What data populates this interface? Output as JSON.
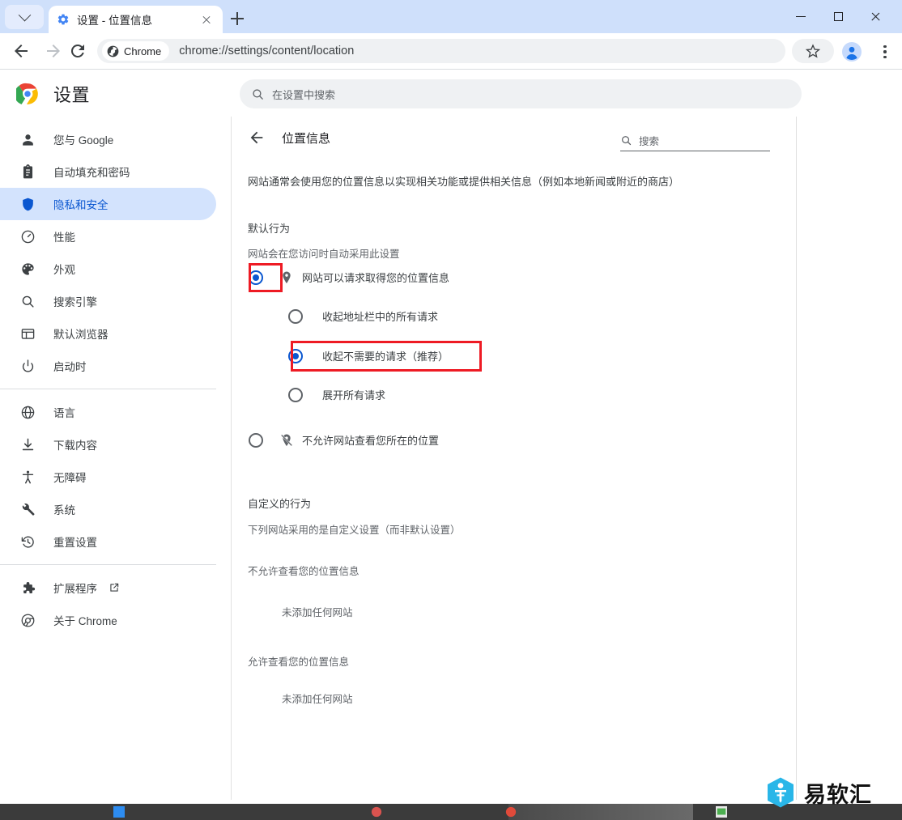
{
  "window": {
    "tab": {
      "title": "设置 - 位置信息",
      "favicon": "gear-icon"
    },
    "new_tab_label": "+",
    "controls": {
      "minimize": "–",
      "maximize": "□",
      "close": "✕"
    }
  },
  "toolbar": {
    "back": "back-arrow-icon",
    "forward": "forward-arrow-icon",
    "reload": "reload-icon",
    "chip_label": "Chrome",
    "url": "chrome://settings/content/location",
    "bookmark": "star-icon",
    "profile": "avatar-icon",
    "menu": "kebab-menu-icon"
  },
  "settings_header": {
    "title": "设置",
    "search_placeholder": "在设置中搜索"
  },
  "sidebar": {
    "items": [
      {
        "label": "您与 Google",
        "icon": "person-icon",
        "active": false
      },
      {
        "label": "自动填充和密码",
        "icon": "clipboard-icon",
        "active": false
      },
      {
        "label": "隐私和安全",
        "icon": "shield-icon",
        "active": true
      },
      {
        "label": "性能",
        "icon": "speedometer-icon",
        "active": false
      },
      {
        "label": "外观",
        "icon": "palette-icon",
        "active": false
      },
      {
        "label": "搜索引擎",
        "icon": "search-icon",
        "active": false
      },
      {
        "label": "默认浏览器",
        "icon": "browser-window-icon",
        "active": false
      },
      {
        "label": "启动时",
        "icon": "power-icon",
        "active": false
      }
    ],
    "items2": [
      {
        "label": "语言",
        "icon": "globe-icon",
        "active": false
      },
      {
        "label": "下载内容",
        "icon": "download-icon",
        "active": false
      },
      {
        "label": "无障碍",
        "icon": "accessibility-icon",
        "active": false
      },
      {
        "label": "系统",
        "icon": "wrench-icon",
        "active": false
      },
      {
        "label": "重置设置",
        "icon": "history-restore-icon",
        "active": false
      }
    ],
    "items3": [
      {
        "label": "扩展程序",
        "icon": "puzzle-icon",
        "external": true,
        "active": false
      },
      {
        "label": "关于 Chrome",
        "icon": "chrome-icon",
        "external": false,
        "active": false
      }
    ]
  },
  "main": {
    "back_icon": "back-arrow-icon",
    "page_title": "位置信息",
    "search_placeholder": "搜索",
    "description": "网站通常会使用您的位置信息以实现相关功能或提供相关信息（例如本地新闻或附近的商店）",
    "default_behavior": {
      "title": "默认行为",
      "subtitle": "网站会在您访问时自动采用此设置",
      "options": [
        {
          "label": "网站可以请求取得您的位置信息",
          "icon": "location-pin-icon",
          "checked": true,
          "highlighted": true
        },
        {
          "label": "不允许网站查看您所在的位置",
          "icon": "location-pin-off-icon",
          "checked": false,
          "highlighted": false
        }
      ],
      "sub_options": [
        {
          "label": "收起地址栏中的所有请求",
          "checked": false,
          "highlighted": false
        },
        {
          "label": "收起不需要的请求（推荐）",
          "checked": true,
          "highlighted": true
        },
        {
          "label": "展开所有请求",
          "checked": false,
          "highlighted": false
        }
      ]
    },
    "custom_behavior": {
      "title": "自定义的行为",
      "subtitle": "下列网站采用的是自定义设置（而非默认设置）",
      "groups": [
        {
          "title": "不允许查看您的位置信息",
          "empty_text": "未添加任何网站"
        },
        {
          "title": "允许查看您的位置信息",
          "empty_text": "未添加任何网站"
        }
      ]
    }
  },
  "watermark": {
    "text": "易软汇",
    "logo": "hexagon-logo-icon"
  },
  "colors": {
    "accent_blue": "#0b57d0",
    "tab_strip": "#cfe0fb",
    "active_nav_bg": "#d3e3fd",
    "annotation_red": "#ee1b24",
    "watermark_blue": "#29b6e8"
  }
}
